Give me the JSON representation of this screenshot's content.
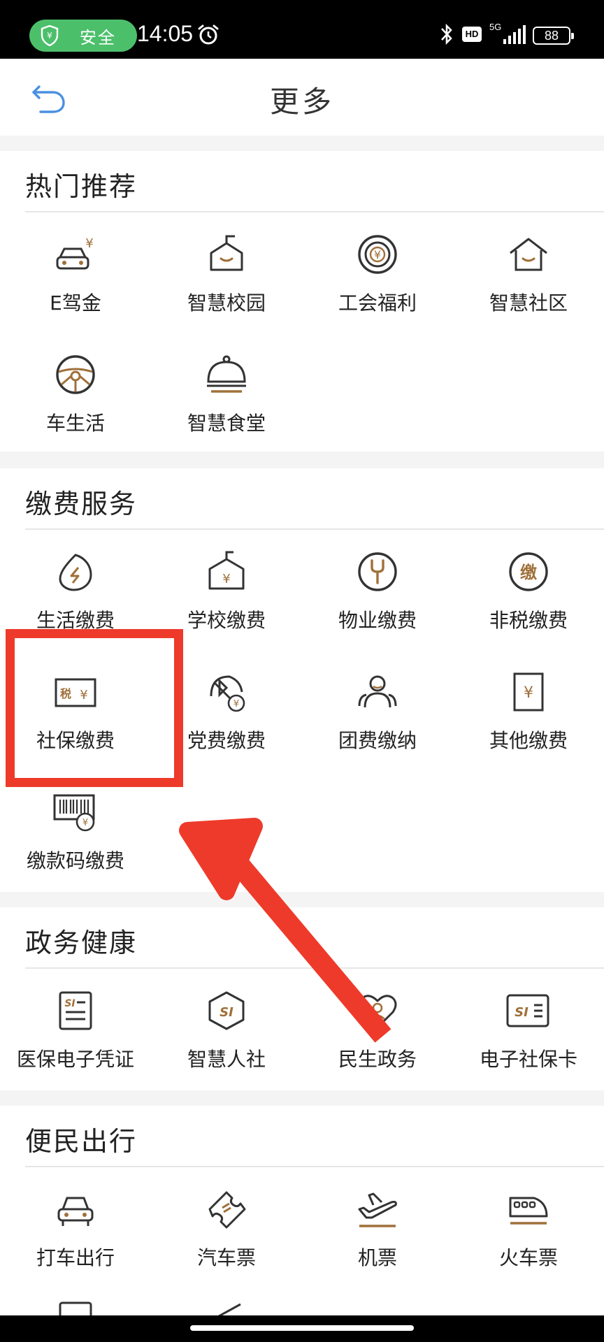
{
  "status_bar": {
    "safe_label": "安全",
    "time": "14:05",
    "net": "5G",
    "hd": "HD",
    "battery": "88"
  },
  "header": {
    "title": "更多"
  },
  "sections": [
    {
      "title": "热门推荐",
      "items": [
        "E驾金",
        "智慧校园",
        "工会福利",
        "智慧社区",
        "车生活",
        "智慧食堂"
      ]
    },
    {
      "title": "缴费服务",
      "items": [
        "生活缴费",
        "学校缴费",
        "物业缴费",
        "非税缴费",
        "社保缴费",
        "党费缴费",
        "团费缴纳",
        "其他缴费",
        "缴款码缴费"
      ]
    },
    {
      "title": "政务健康",
      "items": [
        "医保电子凭证",
        "智慧人社",
        "民生政务",
        "电子社保卡"
      ]
    },
    {
      "title": "便民出行",
      "items": [
        "打车出行",
        "汽车票",
        "机票",
        "火车票"
      ]
    }
  ],
  "icon_glyphs": {
    "fei_shui": "缴",
    "shui": "税",
    "yuan": "¥",
    "si": "SI"
  },
  "colors": {
    "accent": "#a0703a",
    "dark": "#333333",
    "annotation": "#ee3a2a",
    "safe_green": "#4cbf6b"
  }
}
